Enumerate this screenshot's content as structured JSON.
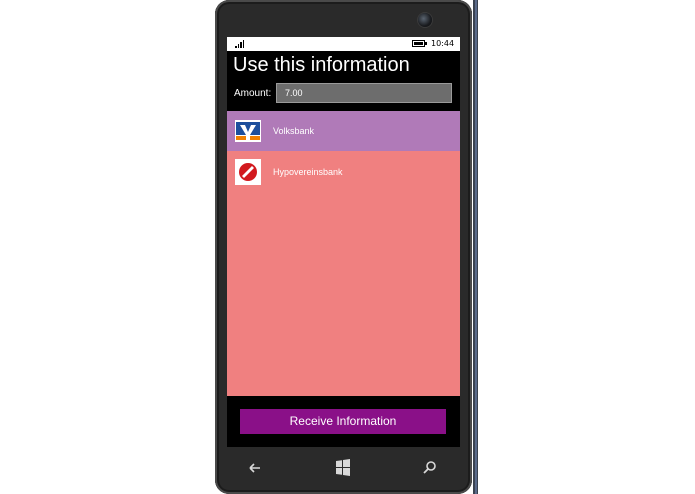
{
  "status_bar": {
    "time": "10:44"
  },
  "page": {
    "title": "Use this information",
    "amount_label": "Amount:",
    "amount_value": "7.00"
  },
  "banks": [
    {
      "name": "Volksbank",
      "icon": "volksbank-logo-icon",
      "selected": true
    },
    {
      "name": "Hypovereinsbank",
      "icon": "hypovereinsbank-logo-icon",
      "selected": false
    }
  ],
  "actions": {
    "receive_label": "Receive Information"
  },
  "navbar": {
    "back_icon": "back-arrow-icon",
    "start_icon": "windows-start-icon",
    "search_icon": "search-icon"
  },
  "colors": {
    "list_background": "#f08080",
    "selected_item": "#b07ab8",
    "button": "#8a1088",
    "screen": "#000000"
  }
}
